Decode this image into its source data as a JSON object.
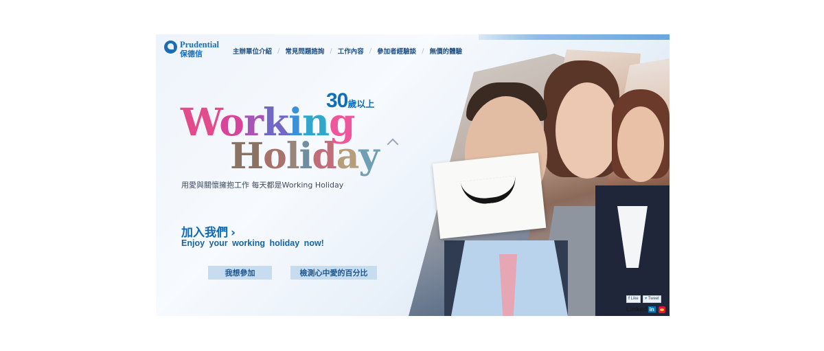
{
  "brand": {
    "name_en": "Prudential",
    "name_zh": "保德信"
  },
  "nav": {
    "items": [
      {
        "label": "主辦單位介紹"
      },
      {
        "label": "常見問題諮詢"
      },
      {
        "label": "工作內容"
      },
      {
        "label": "參加者經驗談"
      },
      {
        "label": "無價的體驗"
      }
    ],
    "separator": "/"
  },
  "hero": {
    "age_number": "30",
    "age_suffix": "歲以上",
    "title_line1": [
      "W",
      "o",
      "r",
      "k",
      "i",
      "n",
      "g"
    ],
    "title_line2": [
      "H",
      "o",
      "l",
      "i",
      "d",
      "a",
      "y"
    ],
    "title_line1_colors": [
      "#e24c8c",
      "#d8449a",
      "#a654b6",
      "#7168c6",
      "#3d8fd6",
      "#33a7c9",
      "#f0569b"
    ],
    "title_line2_colors": [
      "#8a7363",
      "#a8726a",
      "#97847a",
      "#6f8ea2",
      "#c06e78",
      "#b69e7a",
      "#6e9fb3"
    ],
    "tagline": "用愛與關懷擁抱工作  每天都是Working Holiday"
  },
  "cta": {
    "join_label": "加入我們",
    "join_arrow": "›",
    "enjoy_text": "Enjoy  your  working holiday now!",
    "buttons": [
      {
        "label": "我想參加"
      },
      {
        "label": "檢測心中愛的百分比"
      }
    ]
  },
  "social": {
    "like": "Like",
    "tweet": "Tweet",
    "linkedin_text": "Linked",
    "linkedin_in": "in",
    "icons": [
      "facebook-icon",
      "twitter-icon",
      "linkedin-icon",
      "weibo-icon"
    ]
  },
  "colors": {
    "brand_blue": "#1b6bb5",
    "button_bg": "#c7dcee",
    "join_blue": "#0f69b4"
  }
}
